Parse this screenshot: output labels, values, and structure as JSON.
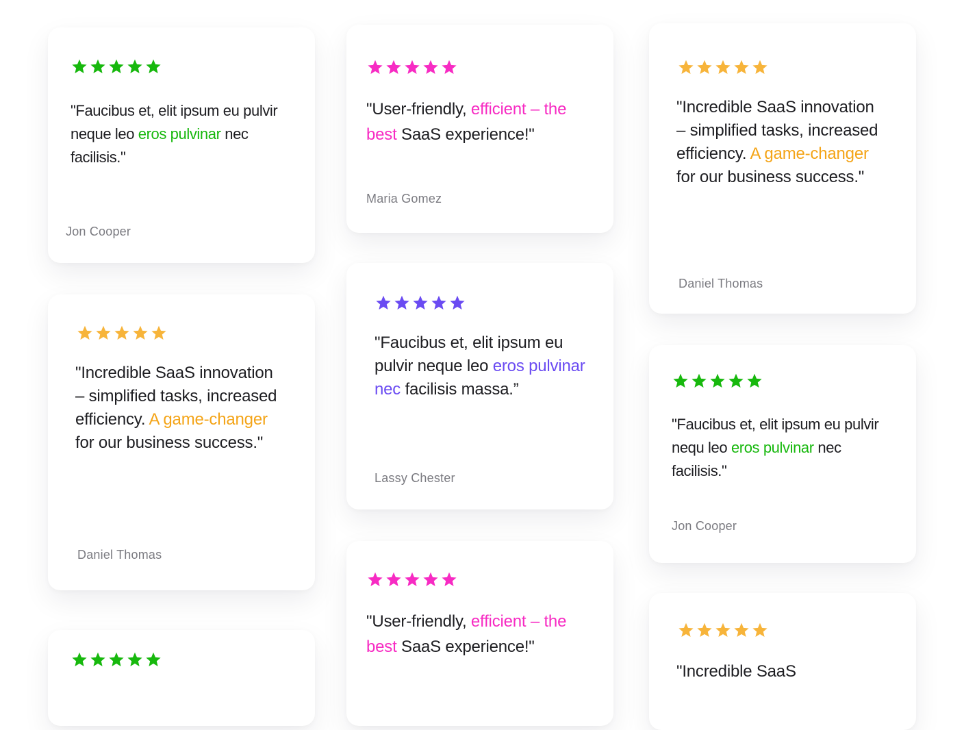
{
  "colors": {
    "green": "#17b80d",
    "pink": "#f72bc3",
    "orange": "#f4a417",
    "star_orange": "#f7b43a",
    "purple": "#6a4bf2",
    "text": "#1d1d21",
    "author": "#7a7a80"
  },
  "testimonials": [
    {
      "stars": 5,
      "star_icon": "star-icon",
      "quote_pre": "\"Faucibus et, elit ipsum eu pulvir neque leo ",
      "quote_hl": "eros pulvinar",
      "quote_post": " nec facilisis.\"",
      "author": "Jon Cooper"
    },
    {
      "stars": 5,
      "quote_pre": "\"User-friendly, ",
      "quote_hl": "efficient – the best",
      "quote_post": " SaaS experience!\"",
      "author": "Maria Gomez"
    },
    {
      "stars": 5,
      "quote_pre": "\"Incredible SaaS innovation – simplified tasks, increased efficiency. ",
      "quote_hl": "A game-changer",
      "quote_post": " for our business success.\"",
      "author": "Daniel Thomas"
    },
    {
      "stars": 5,
      "quote_pre": "\"Incredible SaaS innovation – simplified tasks, increased efficiency. ",
      "quote_hl": "A game-changer",
      "quote_post": " for our business success.\"",
      "author": "Daniel Thomas"
    },
    {
      "stars": 5,
      "quote_pre": "\"Faucibus et, elit ipsum eu pulvir neque leo ",
      "quote_hl": "eros pulvinar nec",
      "quote_post": " facilisis massa.”",
      "author": "Lassy Chester"
    },
    {
      "stars": 5,
      "quote_pre": "\"Faucibus et, elit ipsum eu pulvir nequ leo ",
      "quote_hl": "eros pulvinar",
      "quote_post": " nec facilisis.\"",
      "author": "Jon Cooper"
    },
    {
      "stars": 5
    },
    {
      "stars": 5,
      "quote_pre": "\"User-friendly, ",
      "quote_hl": "efficient – the best",
      "quote_post": " SaaS experience!\""
    },
    {
      "stars": 5,
      "quote_pre": "\"Incredible SaaS"
    }
  ]
}
